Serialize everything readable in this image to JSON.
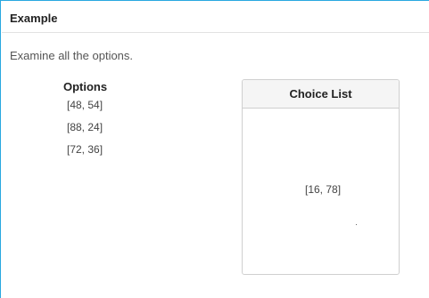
{
  "panel": {
    "title": "Example",
    "instruction": "Examine all the options."
  },
  "options": {
    "header": "Options",
    "items": [
      "[48, 54]",
      "[88, 24]",
      "[72, 36]"
    ]
  },
  "choice_list": {
    "header": "Choice List",
    "items": [
      "[16, 78]"
    ]
  }
}
